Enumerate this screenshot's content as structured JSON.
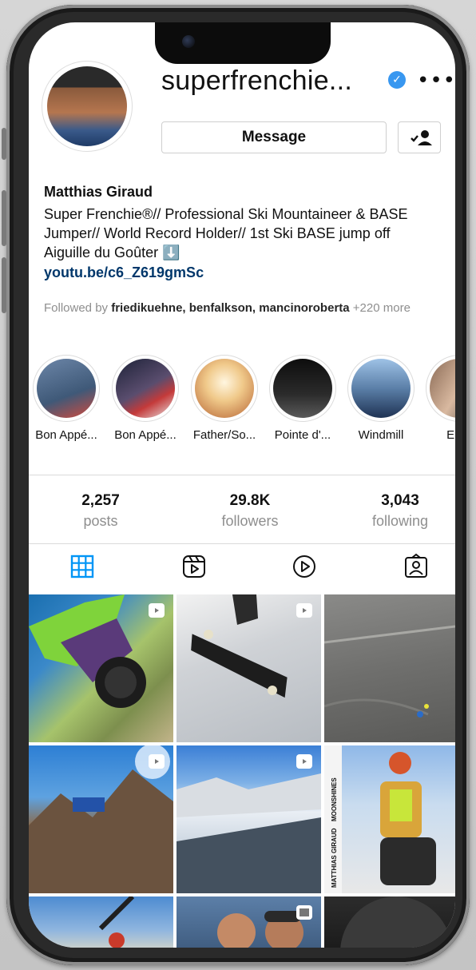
{
  "profile": {
    "username": "superfrenchie...",
    "verified": true,
    "message_label": "Message",
    "display_name": "Matthias Giraud",
    "bio_lines": [
      "Super Frenchie®// Professional Ski Mountaineer & BASE",
      "Jumper// World Record Holder// 1st Ski BASE jump off",
      "Aiguille du Goûter ⬇️"
    ],
    "link": "youtu.be/c6_Z619gmSc",
    "followed_by_prefix": "Followed by ",
    "followed_by_names": "friedikuehne, benfalkson, mancinoroberta",
    "followed_by_suffix": " +220 more"
  },
  "highlights": [
    {
      "label": "Bon Appé..."
    },
    {
      "label": "Bon Appé..."
    },
    {
      "label": "Father/So..."
    },
    {
      "label": "Pointe d'..."
    },
    {
      "label": "Windmill"
    },
    {
      "label": "Euro"
    }
  ],
  "stats": [
    {
      "value": "2,257",
      "label": "posts"
    },
    {
      "value": "29.8K",
      "label": "followers"
    },
    {
      "value": "3,043",
      "label": "following"
    }
  ],
  "tabs": [
    "grid-icon",
    "reels-icon",
    "video-icon",
    "tagged-icon"
  ],
  "colors": {
    "link": "#00376b",
    "verified": "#3897f0",
    "tab_active": "#0095f6"
  },
  "post_overlay_texts": [
    "MATTHIAS GIRAUD",
    "MOONSHINES"
  ]
}
